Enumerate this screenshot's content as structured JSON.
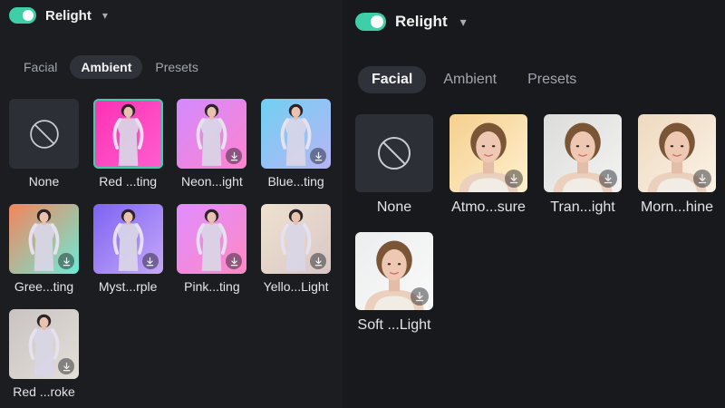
{
  "left": {
    "title": "Relight",
    "tabs": [
      {
        "label": "Facial",
        "active": false
      },
      {
        "label": "Ambient",
        "active": true
      },
      {
        "label": "Presets",
        "active": false
      }
    ],
    "items": [
      {
        "label": "None",
        "type": "none",
        "selected": false,
        "download": false
      },
      {
        "label": "Red ...ting",
        "type": "ambient",
        "bg": [
          "#ff2fb3",
          "#ff5fd0"
        ],
        "selected": true,
        "download": false
      },
      {
        "label": "Neon...ight",
        "type": "ambient",
        "bg": [
          "#d28aff",
          "#ff83cf"
        ],
        "selected": false,
        "download": true
      },
      {
        "label": "Blue...ting",
        "type": "ambient",
        "bg": [
          "#6fd0f2",
          "#b9b5f6"
        ],
        "selected": false,
        "download": true
      },
      {
        "label": "Gree...ting",
        "type": "ambient",
        "bg": [
          "#f3855c",
          "#6cebd7"
        ],
        "selected": false,
        "download": true
      },
      {
        "label": "Myst...rple",
        "type": "ambient",
        "bg": [
          "#7d63f2",
          "#c6a8f9"
        ],
        "selected": false,
        "download": true
      },
      {
        "label": "Pink...ting",
        "type": "ambient",
        "bg": [
          "#e08dff",
          "#ff88c4"
        ],
        "selected": false,
        "download": true
      },
      {
        "label": "Yello...Light",
        "type": "ambient",
        "bg": [
          "#efe2cf",
          "#d9c7c6"
        ],
        "selected": false,
        "download": true
      },
      {
        "label": "Red ...roke",
        "type": "ambient",
        "bg": [
          "#c9c4c2",
          "#e3ded8"
        ],
        "selected": false,
        "download": true
      }
    ]
  },
  "right": {
    "title": "Relight",
    "tabs": [
      {
        "label": "Facial",
        "active": true
      },
      {
        "label": "Ambient",
        "active": false
      },
      {
        "label": "Presets",
        "active": false
      }
    ],
    "items": [
      {
        "label": "None",
        "type": "none",
        "selected": false,
        "download": false
      },
      {
        "label": "Atmo...sure",
        "type": "facial",
        "bg": [
          "#f5cf8e",
          "#fff1cf"
        ],
        "selected": false,
        "download": true
      },
      {
        "label": "Tran...ight",
        "type": "facial",
        "bg": [
          "#dcdcdb",
          "#f3f3f2"
        ],
        "selected": false,
        "download": true
      },
      {
        "label": "Morn...hine",
        "type": "facial",
        "bg": [
          "#eed9bf",
          "#fbf3e7"
        ],
        "selected": false,
        "download": true
      },
      {
        "label": "Soft ...Light",
        "type": "facial",
        "bg": [
          "#ecedee",
          "#fafafa"
        ],
        "selected": false,
        "download": true
      }
    ]
  }
}
